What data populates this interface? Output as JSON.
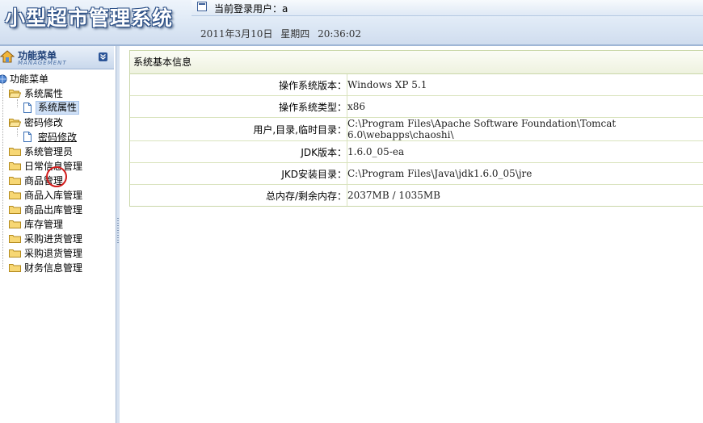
{
  "app": {
    "title": "小型超市管理系统",
    "current_user_label": "当前登录用户：a",
    "date_text": "2011年3月10日",
    "weekday_text": "星期四",
    "time_text": "20:36:02"
  },
  "sidebar": {
    "title": "功能菜单",
    "subtitle": "MANAGEMENT",
    "tree": {
      "root": "功能菜单",
      "items": [
        {
          "label": "系统属性",
          "type": "folder",
          "expanded": true
        },
        {
          "label": "系统属性",
          "type": "doc",
          "selected": true
        },
        {
          "label": "密码修改",
          "type": "folder",
          "expanded": true
        },
        {
          "label": "密码修改",
          "type": "doc"
        },
        {
          "label": "系统管理员",
          "type": "folder"
        },
        {
          "label": "日常信息管理",
          "type": "folder"
        },
        {
          "label": "商品管理",
          "type": "folder"
        },
        {
          "label": "商品入库管理",
          "type": "folder"
        },
        {
          "label": "商品出库管理",
          "type": "folder"
        },
        {
          "label": "库存管理",
          "type": "folder"
        },
        {
          "label": "采购进货管理",
          "type": "folder"
        },
        {
          "label": "采购退货管理",
          "type": "folder"
        },
        {
          "label": "财务信息管理",
          "type": "folder"
        }
      ]
    }
  },
  "main": {
    "panel_title": "系统基本信息",
    "rows": [
      {
        "key": "操作系统版本：",
        "value": "Windows XP  5.1"
      },
      {
        "key": "操作系统类型：",
        "value": "x86"
      },
      {
        "key": "用户,目录,临时目录：",
        "value": "C:\\Program Files\\Apache Software Foundation\\Tomcat 6.0\\webapps\\chaoshi\\"
      },
      {
        "key": "JDK版本：",
        "value": "1.6.0_05-ea"
      },
      {
        "key": "JKD安装目录：",
        "value": "C:\\Program Files\\Java\\jdk1.6.0_05\\jre"
      },
      {
        "key": "总内存/剩余内存：",
        "value": "2037MB  /  1035MB"
      }
    ]
  },
  "colors": {
    "header_bg": "#dde8f5",
    "title_outline": "#2a4e86",
    "panel_border": "#c9d7a8",
    "selected_bg": "#cfe0f6"
  }
}
